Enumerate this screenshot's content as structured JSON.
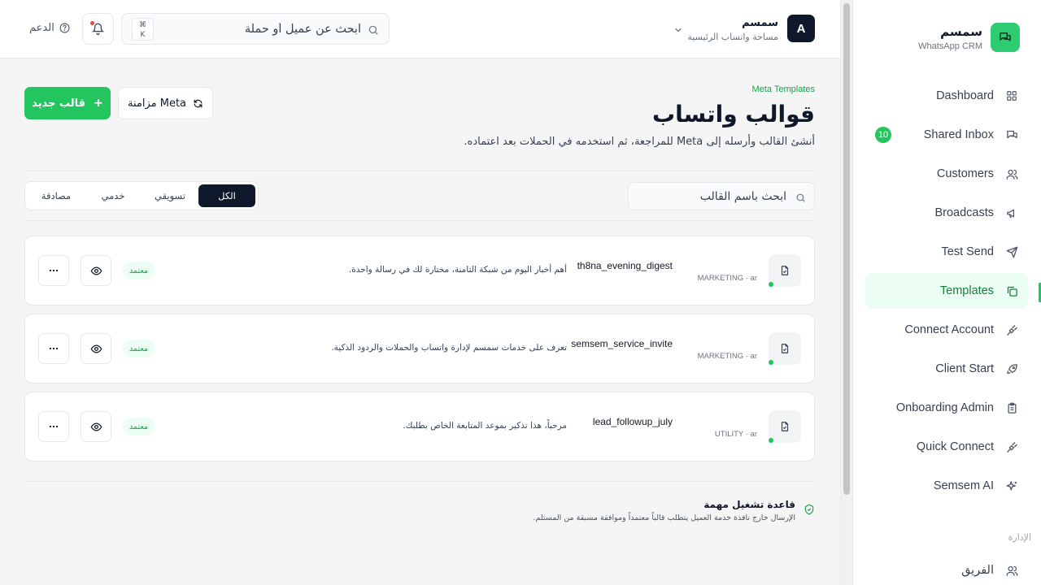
{
  "sidebar": {
    "brand_name": "سمسم",
    "brand_sub": "WhatsApp CRM",
    "items": [
      {
        "label": "Dashboard",
        "icon": "grid-icon"
      },
      {
        "label": "Shared Inbox",
        "icon": "chat-icon",
        "badge": "10"
      },
      {
        "label": "Customers",
        "icon": "users-icon"
      },
      {
        "label": "Broadcasts",
        "icon": "megaphone-icon"
      },
      {
        "label": "Test Send",
        "icon": "send-icon"
      },
      {
        "label": "Templates",
        "icon": "copy-icon",
        "active": true
      },
      {
        "label": "Connect Account",
        "icon": "plug-icon"
      },
      {
        "label": "Client Start",
        "icon": "rocket-icon"
      },
      {
        "label": "Onboarding Admin",
        "icon": "clipboard-icon"
      },
      {
        "label": "Quick Connect",
        "icon": "plug-icon"
      },
      {
        "label": "Semsem AI",
        "icon": "sparkles-icon"
      }
    ],
    "section_label": "الإدارة",
    "team_label": "الفريق"
  },
  "header": {
    "avatar_letter": "A",
    "workspace_name": "سمسم",
    "workspace_sub": "مساحة واتساب الرئيسية",
    "search_placeholder": "ابحث عن عميل أو حملة",
    "kbd_cmd": "⌘",
    "kbd_key": "K",
    "support_label": "الدعم"
  },
  "page": {
    "eyebrow": "Meta Templates",
    "title": "قوالب واتساب",
    "description": "أنشئ القالب وأرسله إلى Meta للمراجعة، ثم استخدمه في الحملات بعد اعتماده.",
    "new_button": "قالب جديد",
    "sync_button": "مزامنة Meta"
  },
  "filters": {
    "search_placeholder": "ابحث باسم القالب",
    "tabs": [
      {
        "label": "الكل",
        "active": true
      },
      {
        "label": "تسويقي",
        "active": false
      },
      {
        "label": "خدمي",
        "active": false
      },
      {
        "label": "مصادقة",
        "active": false
      }
    ]
  },
  "templates": [
    {
      "name": "th8na_evening_digest",
      "meta": "MARKETING · ar",
      "body": "أهم أخبار اليوم من شبكة الثامنة، مختارة لك في رسالة واحدة.",
      "status": "معتمد"
    },
    {
      "name": "semsem_service_invite",
      "meta": "MARKETING · ar",
      "body": "تعرف على خدمات سمسم لإدارة واتساب والحملات والردود الذكية.",
      "status": "معتمد"
    },
    {
      "name": "lead_followup_july",
      "meta": "UTILITY · ar",
      "body": "مرحباً، هذا تذكير بموعد المتابعة الخاص بطلبك.",
      "status": "معتمد"
    }
  ],
  "rule": {
    "title": "قاعدة تشغيل مهمة",
    "description": "الإرسال خارج نافذة خدمة العميل يتطلب قالباً معتمداً وموافقة مسبقة من المستلم."
  },
  "colors": {
    "accent": "#22c55e",
    "accent_text": "#16a34a",
    "dark": "#0f172a",
    "status_bg": "#ecfdf3"
  }
}
